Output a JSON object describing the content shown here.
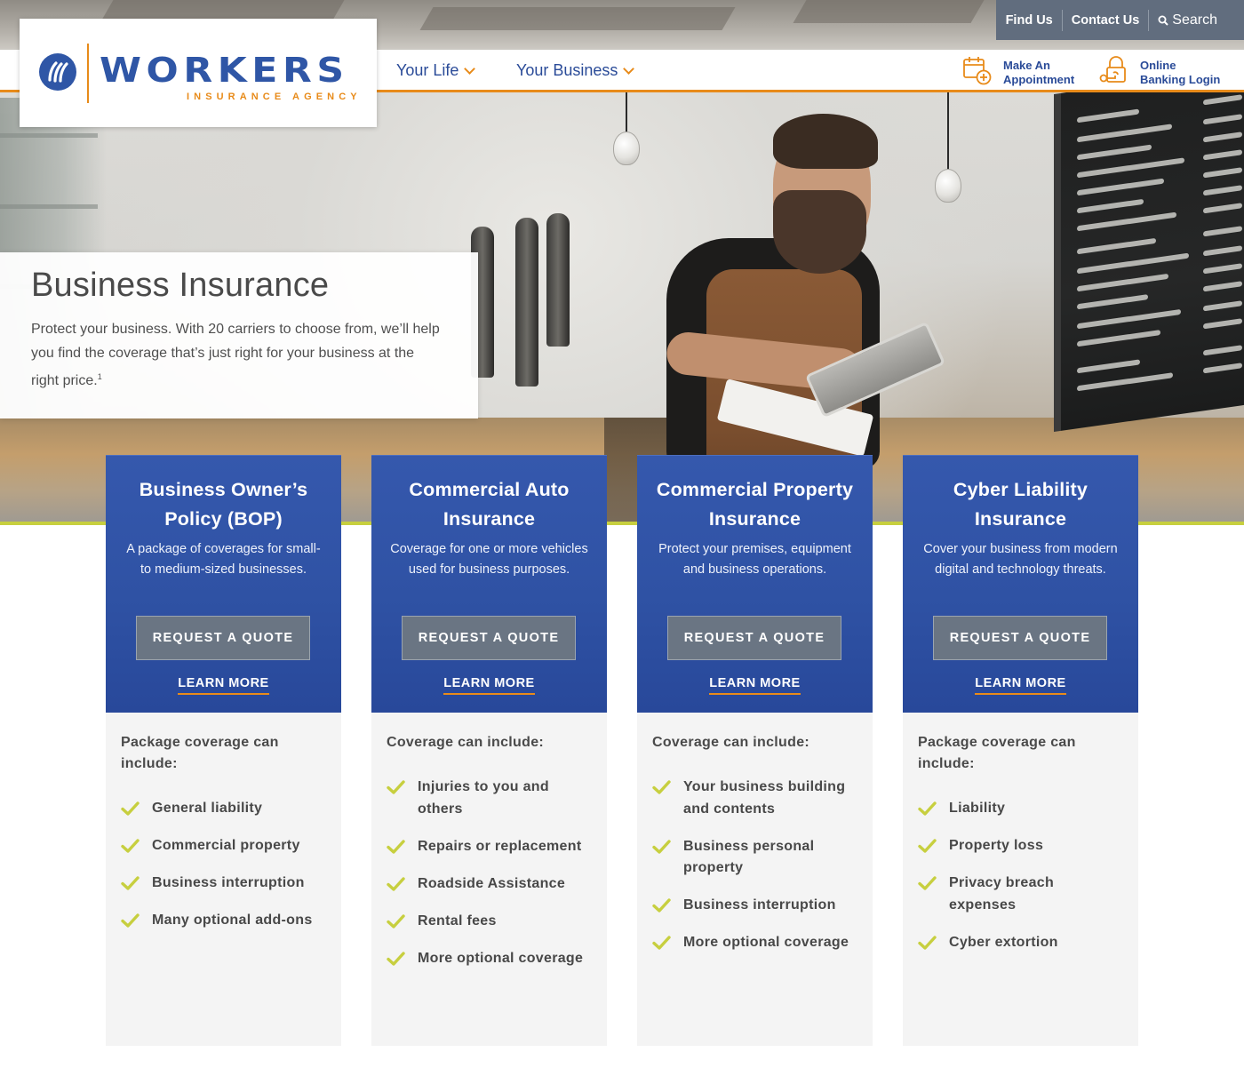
{
  "brand": {
    "name": "WORKERS",
    "tagline": "INSURANCE AGENCY",
    "colors": {
      "primary_blue": "#2f56a6",
      "nav_blue": "#2a4b98",
      "accent_orange": "#e88b1a",
      "accent_green": "#c7cf3f",
      "utility_gray": "#616d7e",
      "button_gray": "#6a7583",
      "card_panel": "#f4f4f4"
    }
  },
  "utility_nav": {
    "items": [
      {
        "label": "Find Us"
      },
      {
        "label": "Contact Us"
      },
      {
        "label": "Search",
        "icon": "search-icon"
      }
    ]
  },
  "main_nav": {
    "items": [
      {
        "label": "Your Life",
        "icon": "chevron-down-icon"
      },
      {
        "label": "Your Business",
        "icon": "chevron-down-icon"
      }
    ],
    "actions": [
      {
        "line1": "Make An",
        "line2": "Appointment",
        "icon": "calendar-add-icon"
      },
      {
        "line1": "Online",
        "line2": "Banking Login",
        "icon": "lock-key-icon"
      }
    ]
  },
  "hero": {
    "title": "Business Insurance",
    "body": "Protect your business. With 20 carriers to choose from, we’ll help you find the coverage that’s just right for your business at the right price.",
    "footnote_marker": "1"
  },
  "cards": [
    {
      "title": "Business Owner’s Policy (BOP)",
      "description": "A package of coverages for small- to medium-sized businesses.",
      "quote_label": "REQUEST A QUOTE",
      "learn_label": "LEARN MORE",
      "list_heading": "Package coverage can include:",
      "items": [
        "General liability",
        "Commercial property",
        "Business interruption",
        "Many optional add-ons"
      ]
    },
    {
      "title": "Commercial Auto Insurance",
      "description": "Coverage for one or more vehicles used for business purposes.",
      "quote_label": "REQUEST A QUOTE",
      "learn_label": "LEARN MORE",
      "list_heading": "Coverage can include:",
      "items": [
        "Injuries to you and others",
        "Repairs or replacement",
        "Roadside Assistance",
        "Rental fees",
        "More optional coverage"
      ]
    },
    {
      "title": "Commercial Property Insurance",
      "description": "Protect your premises, equipment and business operations.",
      "quote_label": "REQUEST A QUOTE",
      "learn_label": "LEARN MORE",
      "list_heading": "Coverage can include:",
      "items": [
        "Your business building and contents",
        "Business personal property",
        "Business interruption",
        "More optional coverage"
      ]
    },
    {
      "title": "Cyber Liability Insurance",
      "description": "Cover your business from modern digital and technology threats.",
      "quote_label": "REQUEST A QUOTE",
      "learn_label": "LEARN MORE",
      "list_heading": "Package coverage can include:",
      "items": [
        "Liability",
        "Property loss",
        "Privacy breach expenses",
        "Cyber extortion"
      ]
    }
  ]
}
